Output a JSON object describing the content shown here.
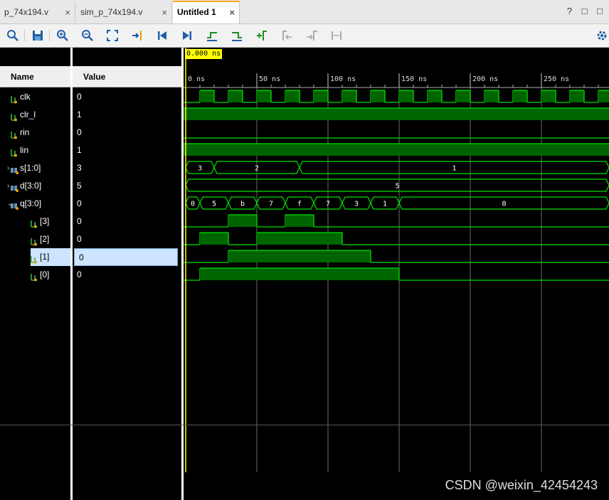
{
  "tabs": [
    {
      "label": "p_74x194.v",
      "close": "×"
    },
    {
      "label": "sim_p_74x194.v",
      "close": "×"
    },
    {
      "label": "Untitled 1",
      "close": "×"
    }
  ],
  "window_controls": "? □ □",
  "toolbar": {
    "icons": [
      "search-icon",
      "save-icon",
      "zoom-in-icon",
      "zoom-out-icon",
      "zoom-fit-icon",
      "go-to-cursor-icon",
      "go-to-time-0-icon",
      "go-to-last-time-icon",
      "previous-transition-icon",
      "next-transition-icon",
      "add-marker-icon",
      "previous-marker-icon",
      "next-marker-icon",
      "swap-cursors-icon",
      "settings-icon"
    ]
  },
  "columns": {
    "name": "Name",
    "value": "Value"
  },
  "cursor_time": "0.000 ns",
  "time_ticks": [
    "0 ns",
    "50 ns",
    "100 ns",
    "150 ns",
    "200 ns",
    "250 ns"
  ],
  "signals": [
    {
      "name": "clk",
      "value": "0",
      "type": "bit"
    },
    {
      "name": "clr_l",
      "value": "1",
      "type": "bit"
    },
    {
      "name": "rin",
      "value": "0",
      "type": "bit"
    },
    {
      "name": "lin",
      "value": "1",
      "type": "bit"
    },
    {
      "name": "s[1:0]",
      "value": "3",
      "type": "bus",
      "expander": "›"
    },
    {
      "name": "d[3:0]",
      "value": "5",
      "type": "bus",
      "expander": "›"
    },
    {
      "name": "q[3:0]",
      "value": "0",
      "type": "bus",
      "expander": "⌄"
    },
    {
      "name": "[3]",
      "value": "0",
      "type": "bit"
    },
    {
      "name": "[2]",
      "value": "0",
      "type": "bit"
    },
    {
      "name": "[1]",
      "value": "0",
      "type": "bit",
      "selected": true
    },
    {
      "name": "[0]",
      "value": "0",
      "type": "bit"
    }
  ],
  "bus_values": {
    "s": [
      "3",
      "2",
      "1"
    ],
    "d": [
      "5"
    ],
    "q": [
      "0",
      "5",
      "b",
      "7",
      "f",
      "7",
      "3",
      "1",
      "0"
    ]
  },
  "watermark": "CSDN @weixin_42454243",
  "colors": {
    "wave": "#00e000",
    "fill": "#006400",
    "cursor": "#ffff00",
    "selected": "#cce4ff"
  }
}
